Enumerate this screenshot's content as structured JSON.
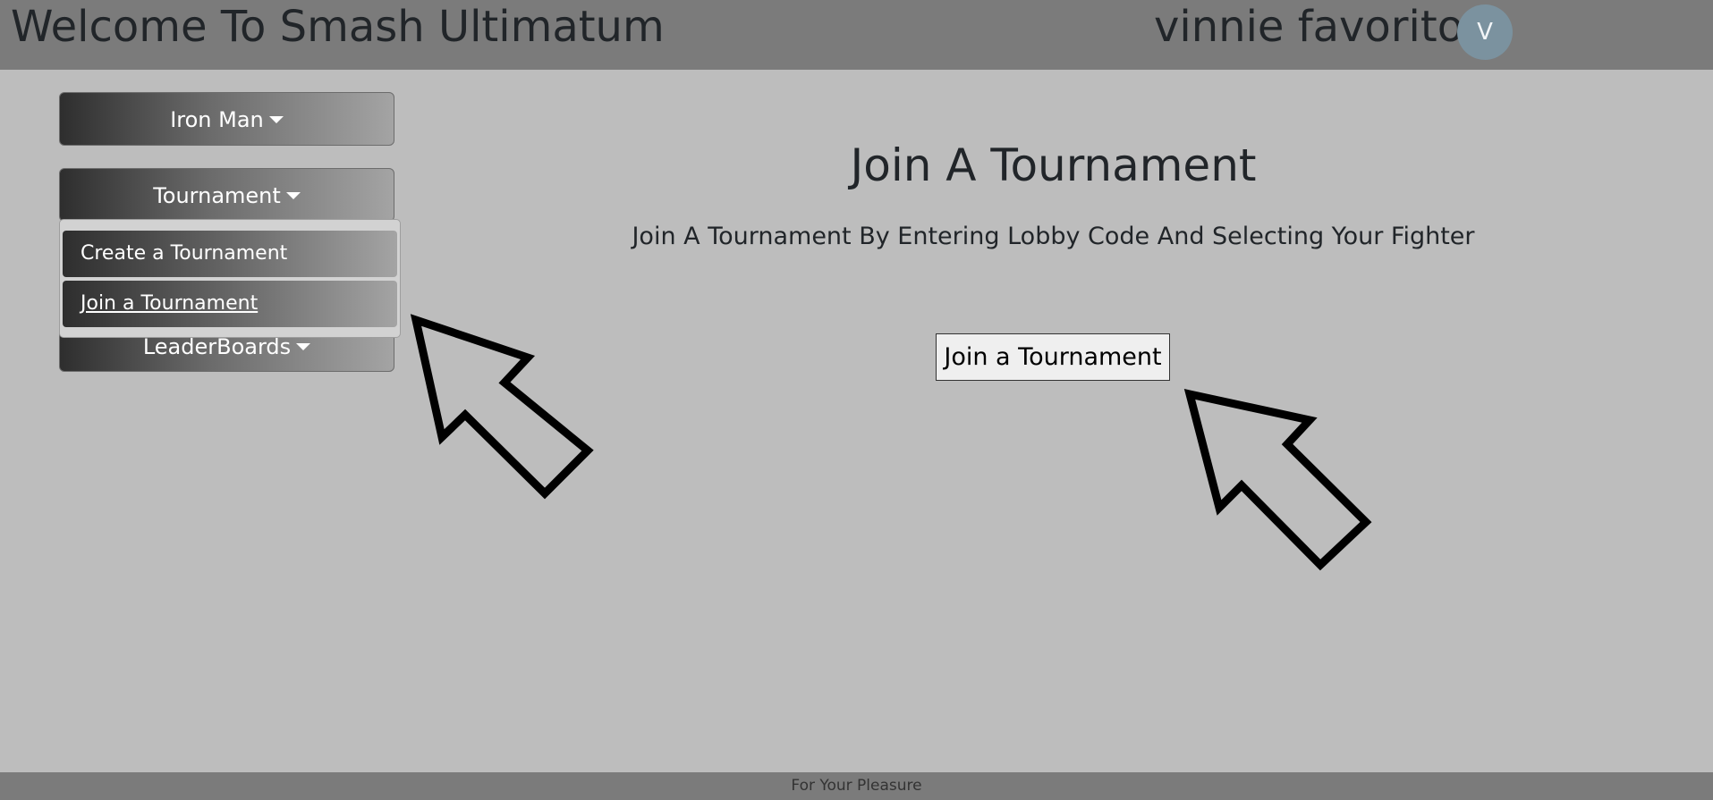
{
  "header": {
    "title": "Welcome To Smash Ultimatum",
    "user_name": "vinnie favorito",
    "avatar_letter": "V"
  },
  "sidebar": {
    "items": [
      {
        "label": "Iron Man"
      },
      {
        "label": "Tournament"
      },
      {
        "label": "LeaderBoards"
      }
    ],
    "dropdown": [
      {
        "label": "Create a Tournament"
      },
      {
        "label": "Join a Tournament"
      }
    ]
  },
  "main": {
    "heading": "Join A Tournament",
    "subheading": "Join A Tournament By Entering Lobby Code And Selecting Your Fighter",
    "button_label": "Join a Tournament"
  },
  "footer": {
    "text": "For Your Pleasure"
  },
  "colors": {
    "page_bg": "#bdbdbd",
    "header_bg": "#7b7b7b",
    "avatar_bg": "#7b929f"
  },
  "icons": {
    "annotation_arrow": "arrow-pointer-icon",
    "dropdown_caret": "caret-down-icon"
  }
}
